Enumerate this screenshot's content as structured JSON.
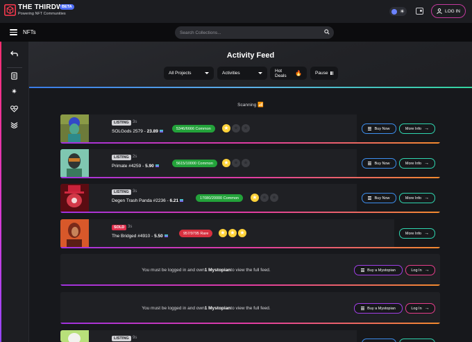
{
  "header": {
    "brand_title": "THE THIRDWEB",
    "brand_subtitle": "Powering NFT Communities",
    "beta_label": "BETA",
    "login_label": "LOG IN"
  },
  "nav": {
    "title": "NFTs",
    "search_placeholder": "Search Collections..."
  },
  "feed": {
    "title": "Activity Feed",
    "filters": [
      "All Projects",
      "Activities",
      "Hot Deals",
      "Pause"
    ],
    "scanning_label": "Scanning"
  },
  "items": [
    {
      "tag": "LISTING",
      "time": "3s",
      "name": "SOLGods 2579 - ",
      "price": "23.89",
      "rank": "5346/6666  Common",
      "stars": 1,
      "buttons": [
        "Buy Now",
        "More Info"
      ]
    },
    {
      "tag": "LISTING",
      "time": "2s",
      "name": "Primate #4259 - ",
      "price": "5.90",
      "rank": "5615/10000  Common",
      "stars": 1,
      "buttons": [
        "Buy Now",
        "More Info"
      ]
    },
    {
      "tag": "LISTING",
      "time": "3s",
      "name": "Degen Trash Panda #2236 - ",
      "price": "6.21",
      "rank": "17080/20000  Common",
      "stars": 1,
      "buttons": [
        "Buy Now",
        "More Info"
      ]
    },
    {
      "tag": "SOLD",
      "time": "3s",
      "name": "The Bridged #4910 - ",
      "price": "5.50",
      "rank": "957/9795  Rare",
      "stars": 3,
      "buttons": [
        "More Info"
      ]
    },
    {
      "tag": "LISTING",
      "time": "9s"
    }
  ],
  "locked": {
    "message_pre": "You must be logged in and own ",
    "message_bold": "1 Mystopian",
    "message_post": " to view the full feed.",
    "buy_label": "Buy a Mystopian",
    "login_label": "Log In"
  },
  "colors": {
    "accent_pink": "#e83e8c",
    "common_green": "#23a23a",
    "rare_red": "#d7303f",
    "sold_red": "#e0304d"
  }
}
